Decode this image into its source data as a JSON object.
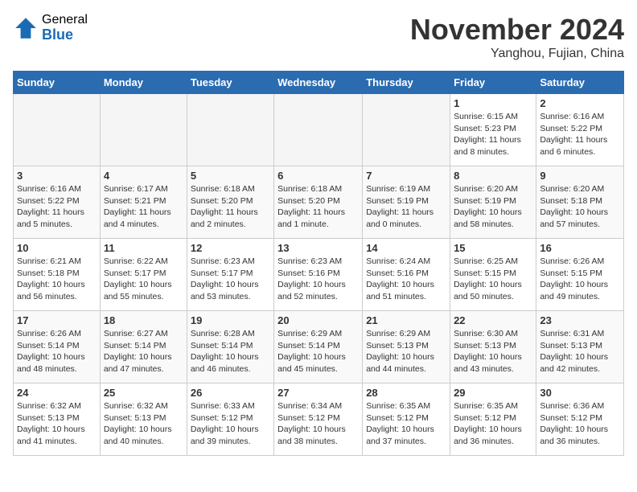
{
  "header": {
    "logo_general": "General",
    "logo_blue": "Blue",
    "month_title": "November 2024",
    "location": "Yanghou, Fujian, China"
  },
  "weekdays": [
    "Sunday",
    "Monday",
    "Tuesday",
    "Wednesday",
    "Thursday",
    "Friday",
    "Saturday"
  ],
  "weeks": [
    [
      {
        "day": "",
        "empty": true
      },
      {
        "day": "",
        "empty": true
      },
      {
        "day": "",
        "empty": true
      },
      {
        "day": "",
        "empty": true
      },
      {
        "day": "",
        "empty": true
      },
      {
        "day": "1",
        "sunrise": "Sunrise: 6:15 AM",
        "sunset": "Sunset: 5:23 PM",
        "daylight": "Daylight: 11 hours and 8 minutes."
      },
      {
        "day": "2",
        "sunrise": "Sunrise: 6:16 AM",
        "sunset": "Sunset: 5:22 PM",
        "daylight": "Daylight: 11 hours and 6 minutes."
      }
    ],
    [
      {
        "day": "3",
        "sunrise": "Sunrise: 6:16 AM",
        "sunset": "Sunset: 5:22 PM",
        "daylight": "Daylight: 11 hours and 5 minutes."
      },
      {
        "day": "4",
        "sunrise": "Sunrise: 6:17 AM",
        "sunset": "Sunset: 5:21 PM",
        "daylight": "Daylight: 11 hours and 4 minutes."
      },
      {
        "day": "5",
        "sunrise": "Sunrise: 6:18 AM",
        "sunset": "Sunset: 5:20 PM",
        "daylight": "Daylight: 11 hours and 2 minutes."
      },
      {
        "day": "6",
        "sunrise": "Sunrise: 6:18 AM",
        "sunset": "Sunset: 5:20 PM",
        "daylight": "Daylight: 11 hours and 1 minute."
      },
      {
        "day": "7",
        "sunrise": "Sunrise: 6:19 AM",
        "sunset": "Sunset: 5:19 PM",
        "daylight": "Daylight: 11 hours and 0 minutes."
      },
      {
        "day": "8",
        "sunrise": "Sunrise: 6:20 AM",
        "sunset": "Sunset: 5:19 PM",
        "daylight": "Daylight: 10 hours and 58 minutes."
      },
      {
        "day": "9",
        "sunrise": "Sunrise: 6:20 AM",
        "sunset": "Sunset: 5:18 PM",
        "daylight": "Daylight: 10 hours and 57 minutes."
      }
    ],
    [
      {
        "day": "10",
        "sunrise": "Sunrise: 6:21 AM",
        "sunset": "Sunset: 5:18 PM",
        "daylight": "Daylight: 10 hours and 56 minutes."
      },
      {
        "day": "11",
        "sunrise": "Sunrise: 6:22 AM",
        "sunset": "Sunset: 5:17 PM",
        "daylight": "Daylight: 10 hours and 55 minutes."
      },
      {
        "day": "12",
        "sunrise": "Sunrise: 6:23 AM",
        "sunset": "Sunset: 5:17 PM",
        "daylight": "Daylight: 10 hours and 53 minutes."
      },
      {
        "day": "13",
        "sunrise": "Sunrise: 6:23 AM",
        "sunset": "Sunset: 5:16 PM",
        "daylight": "Daylight: 10 hours and 52 minutes."
      },
      {
        "day": "14",
        "sunrise": "Sunrise: 6:24 AM",
        "sunset": "Sunset: 5:16 PM",
        "daylight": "Daylight: 10 hours and 51 minutes."
      },
      {
        "day": "15",
        "sunrise": "Sunrise: 6:25 AM",
        "sunset": "Sunset: 5:15 PM",
        "daylight": "Daylight: 10 hours and 50 minutes."
      },
      {
        "day": "16",
        "sunrise": "Sunrise: 6:26 AM",
        "sunset": "Sunset: 5:15 PM",
        "daylight": "Daylight: 10 hours and 49 minutes."
      }
    ],
    [
      {
        "day": "17",
        "sunrise": "Sunrise: 6:26 AM",
        "sunset": "Sunset: 5:14 PM",
        "daylight": "Daylight: 10 hours and 48 minutes."
      },
      {
        "day": "18",
        "sunrise": "Sunrise: 6:27 AM",
        "sunset": "Sunset: 5:14 PM",
        "daylight": "Daylight: 10 hours and 47 minutes."
      },
      {
        "day": "19",
        "sunrise": "Sunrise: 6:28 AM",
        "sunset": "Sunset: 5:14 PM",
        "daylight": "Daylight: 10 hours and 46 minutes."
      },
      {
        "day": "20",
        "sunrise": "Sunrise: 6:29 AM",
        "sunset": "Sunset: 5:14 PM",
        "daylight": "Daylight: 10 hours and 45 minutes."
      },
      {
        "day": "21",
        "sunrise": "Sunrise: 6:29 AM",
        "sunset": "Sunset: 5:13 PM",
        "daylight": "Daylight: 10 hours and 44 minutes."
      },
      {
        "day": "22",
        "sunrise": "Sunrise: 6:30 AM",
        "sunset": "Sunset: 5:13 PM",
        "daylight": "Daylight: 10 hours and 43 minutes."
      },
      {
        "day": "23",
        "sunrise": "Sunrise: 6:31 AM",
        "sunset": "Sunset: 5:13 PM",
        "daylight": "Daylight: 10 hours and 42 minutes."
      }
    ],
    [
      {
        "day": "24",
        "sunrise": "Sunrise: 6:32 AM",
        "sunset": "Sunset: 5:13 PM",
        "daylight": "Daylight: 10 hours and 41 minutes."
      },
      {
        "day": "25",
        "sunrise": "Sunrise: 6:32 AM",
        "sunset": "Sunset: 5:13 PM",
        "daylight": "Daylight: 10 hours and 40 minutes."
      },
      {
        "day": "26",
        "sunrise": "Sunrise: 6:33 AM",
        "sunset": "Sunset: 5:12 PM",
        "daylight": "Daylight: 10 hours and 39 minutes."
      },
      {
        "day": "27",
        "sunrise": "Sunrise: 6:34 AM",
        "sunset": "Sunset: 5:12 PM",
        "daylight": "Daylight: 10 hours and 38 minutes."
      },
      {
        "day": "28",
        "sunrise": "Sunrise: 6:35 AM",
        "sunset": "Sunset: 5:12 PM",
        "daylight": "Daylight: 10 hours and 37 minutes."
      },
      {
        "day": "29",
        "sunrise": "Sunrise: 6:35 AM",
        "sunset": "Sunset: 5:12 PM",
        "daylight": "Daylight: 10 hours and 36 minutes."
      },
      {
        "day": "30",
        "sunrise": "Sunrise: 6:36 AM",
        "sunset": "Sunset: 5:12 PM",
        "daylight": "Daylight: 10 hours and 36 minutes."
      }
    ]
  ]
}
